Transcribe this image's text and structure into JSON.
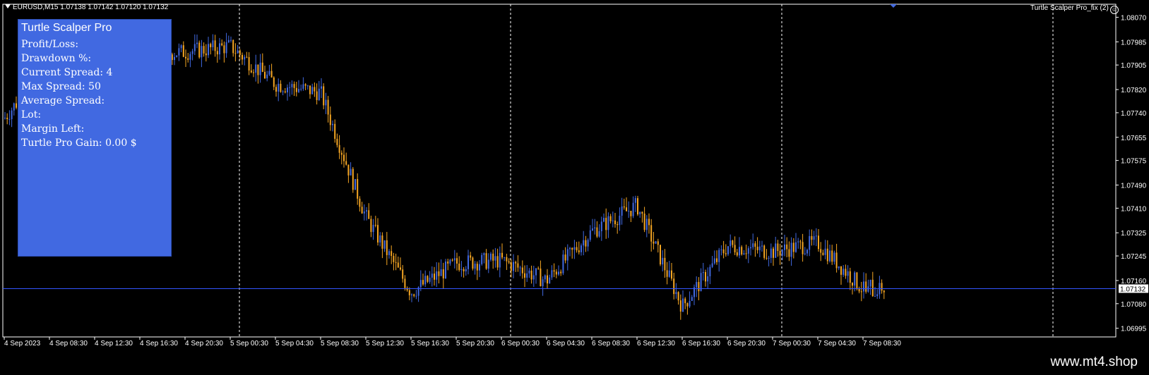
{
  "header": {
    "symbol": "EURUSD,M15",
    "open": "1.07138",
    "high": "1.07142",
    "low": "1.07120",
    "close": "1.07132"
  },
  "indicator_label": "Turtle Scalper Pro_fix (2)",
  "panel": {
    "title": "Turtle Scalper Pro",
    "rows": [
      "Profit/Loss:",
      "Drawdown %:",
      "Current Spread: 4",
      "Max Spread: 50",
      "Average Spread:",
      "Lot:",
      "Margin Left:",
      "Turtle Pro Gain: 0.00 $"
    ]
  },
  "price_axis": {
    "labels": [
      "1.08070",
      "1.07985",
      "1.07905",
      "1.07820",
      "1.07740",
      "1.07655",
      "1.07575",
      "1.07490",
      "1.07410",
      "1.07325",
      "1.07245",
      "1.07160",
      "1.07080",
      "1.06995"
    ],
    "current_price": "1.07132"
  },
  "time_axis": {
    "labels": [
      "4 Sep 2023",
      "4 Sep 08:30",
      "4 Sep 12:30",
      "4 Sep 16:30",
      "4 Sep 20:30",
      "5 Sep 00:30",
      "5 Sep 04:30",
      "5 Sep 08:30",
      "5 Sep 12:30",
      "5 Sep 16:30",
      "5 Sep 20:30",
      "6 Sep 00:30",
      "6 Sep 04:30",
      "6 Sep 08:30",
      "6 Sep 12:30",
      "6 Sep 16:30",
      "6 Sep 20:30",
      "7 Sep 00:30",
      "7 Sep 04:30",
      "7 Sep 08:30"
    ]
  },
  "watermark": "www.mt4.shop",
  "colors": {
    "background": "#000000",
    "bull_candle": "#4169e1",
    "bear_candle": "#f5a623",
    "panel": "#4169e1",
    "price_line": "#3355ff",
    "grid": "#ffffff"
  },
  "chart_data": {
    "type": "candlestick",
    "price_range": [
      1.06965,
      1.08115
    ],
    "price_path_anchors": [
      {
        "time": "4 Sep 2023",
        "price": 1.0772
      },
      {
        "time": "4 Sep 08:30",
        "price": 1.0792
      },
      {
        "time": "4 Sep 20:30",
        "price": 1.0795
      },
      {
        "time": "5 Sep 00:30",
        "price": 1.0797
      },
      {
        "time": "5 Sep 04:30",
        "price": 1.0784
      },
      {
        "time": "5 Sep 08:30",
        "price": 1.0781
      },
      {
        "time": "5 Sep 12:30",
        "price": 1.0738
      },
      {
        "time": "5 Sep 16:30",
        "price": 1.0712
      },
      {
        "time": "5 Sep 20:30",
        "price": 1.0722
      },
      {
        "time": "6 Sep 00:30",
        "price": 1.0723
      },
      {
        "time": "6 Sep 04:30",
        "price": 1.0716
      },
      {
        "time": "6 Sep 08:30",
        "price": 1.0733
      },
      {
        "time": "6 Sep 12:30",
        "price": 1.0742
      },
      {
        "time": "6 Sep 16:30",
        "price": 1.0707
      },
      {
        "time": "6 Sep 20:30",
        "price": 1.0728
      },
      {
        "time": "7 Sep 00:30",
        "price": 1.0726
      },
      {
        "time": "7 Sep 04:30",
        "price": 1.0729
      },
      {
        "time": "7 Sep 08:30",
        "price": 1.0713
      }
    ],
    "period_separators": [
      "5 Sep 00:30",
      "6 Sep 00:30",
      "7 Sep 00:30"
    ],
    "current_price": 1.07132
  }
}
